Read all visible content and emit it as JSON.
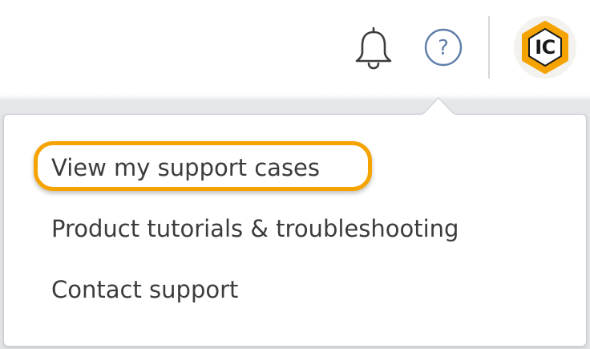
{
  "header": {
    "notifications_icon": "bell-icon",
    "help_icon": "question-circle-icon",
    "help_glyph": "?",
    "avatar": {
      "initials": "IC",
      "hex_color": "#f5a300"
    }
  },
  "help_menu": {
    "items": [
      {
        "label": "View my support cases",
        "highlighted": true
      },
      {
        "label": "Product tutorials & troubleshooting",
        "highlighted": false
      },
      {
        "label": "Contact support",
        "highlighted": false
      }
    ]
  },
  "colors": {
    "highlight": "#f5a300",
    "menu_text": "#3c3c3c",
    "icon_stroke": "#3c3c3c",
    "help_icon_stroke": "#5f7ea8"
  }
}
